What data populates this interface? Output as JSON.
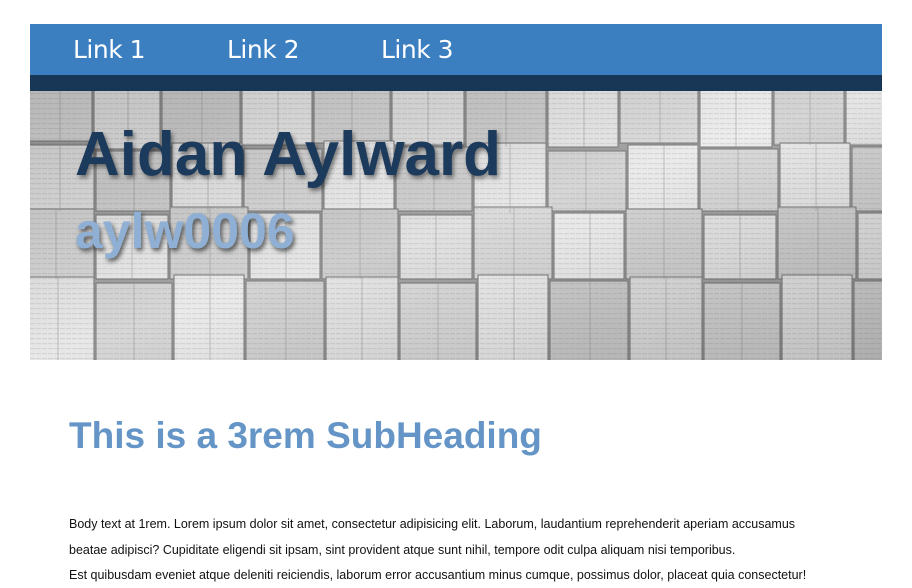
{
  "nav": {
    "links": [
      "Link 1",
      "Link 2",
      "Link 3"
    ]
  },
  "hero": {
    "title": "Aidan Aylward",
    "subtitle": "aylw0006"
  },
  "main": {
    "subheading": "This is a 3rem SubHeading",
    "body_lines": [
      "Body text at 1rem. Lorem ipsum dolor sit amet, consectetur adipisicing elit. Laborum, laudantium reprehenderit aperiam accusamus",
      "beatae adipisci? Cupiditate eligendi sit ipsam, sint provident atque sunt nihil, tempore odit culpa aliquam nisi temporibus.",
      "Est quibusdam eveniet atque deleniti reiciendis, laborum error accusantium minus cumque, possimus dolor, placeat quia consectetur!"
    ]
  },
  "colors": {
    "navbar": "#3c7fc1",
    "navbar_stripe": "#183655",
    "hero_title": "#1b3a5c",
    "hero_subtitle": "#8fb0d4",
    "subheading": "#6495c6"
  }
}
